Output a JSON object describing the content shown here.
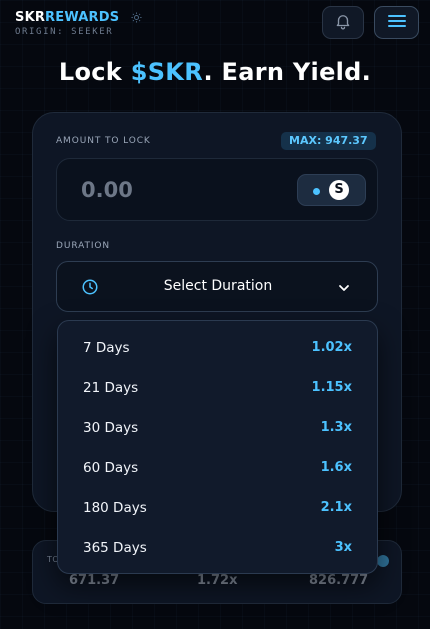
{
  "header": {
    "brand_main": "SKR",
    "brand_accent": "REWARDS",
    "origin": "ORIGIN: SEEKER",
    "icons": [
      "sun-icon",
      "bell-icon",
      "menu-icon"
    ]
  },
  "headline": {
    "prefix": "Lock ",
    "token": "$SKR",
    "suffix": ". Earn Yield."
  },
  "lock_card": {
    "amount_label": "AMOUNT TO LOCK",
    "max_label": "MAX: 947.37",
    "amount_value": "0.00",
    "token_symbol": "S",
    "duration_label": "DURATION",
    "duration_placeholder": "Select Duration"
  },
  "stats": {
    "label_partial": "TO",
    "values": [
      "671.37",
      "1.72x",
      "826.777"
    ]
  },
  "duration_options": [
    {
      "days": "7 Days",
      "multiplier": "1.02x"
    },
    {
      "days": "21 Days",
      "multiplier": "1.15x"
    },
    {
      "days": "30 Days",
      "multiplier": "1.3x"
    },
    {
      "days": "60 Days",
      "multiplier": "1.6x"
    },
    {
      "days": "180 Days",
      "multiplier": "2.1x"
    },
    {
      "days": "365 Days",
      "multiplier": "3x"
    }
  ],
  "colors": {
    "accent": "#4cc2ff",
    "background": "#05080f",
    "card": "#0e1625"
  }
}
